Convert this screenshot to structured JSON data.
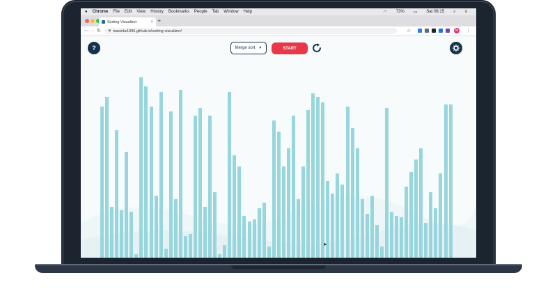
{
  "menubar": {
    "apple": "",
    "items": [
      "Chrome",
      "File",
      "Edit",
      "View",
      "History",
      "Bookmarks",
      "People",
      "Tab",
      "Window",
      "Help"
    ],
    "battery": "73%",
    "clock": "Sat 08:15"
  },
  "browser": {
    "tab_title": "Sorting Visualizer",
    "tab_close": "×",
    "new_tab": "+",
    "url": "maciekz1996.github.io/sorting-visualizer/",
    "back": "←",
    "forward": "→",
    "reload": "↻",
    "star": "☆",
    "menu": "⋮",
    "profile_initial": "M"
  },
  "app": {
    "help_label": "?",
    "algorithm_selected": "Merge sort",
    "start_label": "START",
    "settings_icon": "gear-icon",
    "reset_icon": "reset-icon",
    "bar_color": "#98d6de",
    "accent": "#e63848",
    "dark": "#14324b",
    "bar_values": [
      0.83,
      0.88,
      0.28,
      0.7,
      0.26,
      0.58,
      0.25,
      0.02,
      0.99,
      0.94,
      0.83,
      0.34,
      0.91,
      0.05,
      0.8,
      0.32,
      0.92,
      0.12,
      0.13,
      0.78,
      0.82,
      0.28,
      0.78,
      0.36,
      0.02,
      0.07,
      0.91,
      0.56,
      0.5,
      0.23,
      0.2,
      0.21,
      0.27,
      0.3,
      0.06,
      0.75,
      0.69,
      0.5,
      0.6,
      0.78,
      0.32,
      0.5,
      0.81,
      0.9,
      0.88,
      0.85,
      0.42,
      0.35,
      0.46,
      0.4,
      0.83,
      0.71,
      0.6,
      0.32,
      0.24,
      0.34,
      0.18,
      0.06,
      0.82,
      0.25,
      0.23,
      0.22,
      0.39,
      0.47,
      0.54,
      0.6,
      0.19,
      0.36,
      0.27,
      0.46,
      0.84,
      0.84
    ]
  }
}
